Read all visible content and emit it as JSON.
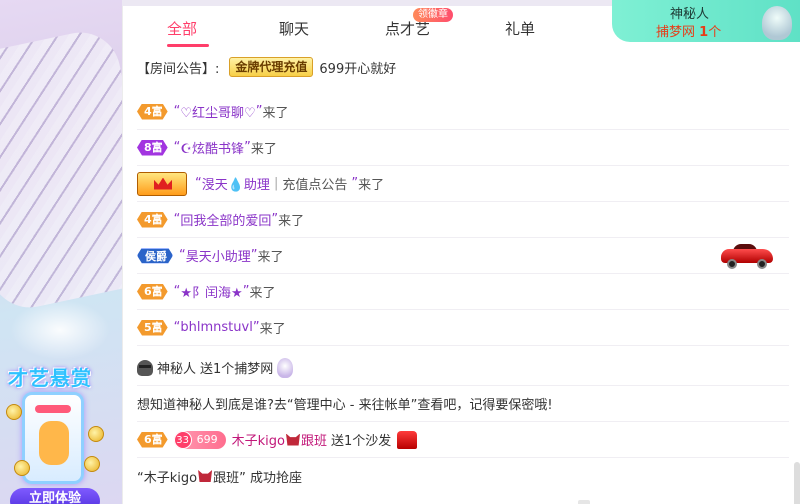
{
  "left": {
    "reward_title": "才艺悬赏",
    "join_button": "立即体验"
  },
  "tabs": [
    {
      "label": "全部",
      "active": true
    },
    {
      "label": "聊天",
      "active": false
    },
    {
      "label": "点才艺",
      "active": false,
      "badge": "领徽章"
    },
    {
      "label": "礼单",
      "active": false
    }
  ],
  "mystery": {
    "name": "神秘人",
    "gift": "捕梦网",
    "count": "1",
    "unit": "个"
  },
  "announcement": {
    "label": "【房间公告】:",
    "tag": "金牌代理充值",
    "text": "699开心就好"
  },
  "messages": [
    {
      "badge": "4富",
      "badge_color": "orange",
      "open_quote": "“",
      "name": "♡红尘哥聊♡",
      "close_quote": "”",
      "action": "来了"
    },
    {
      "badge": "8富",
      "badge_color": "purple",
      "open_quote": "“",
      "name": "☪炫酷书锋",
      "close_quote": "”",
      "action": "来了"
    },
    {
      "badge": "",
      "badge_color": "crown",
      "open_quote": "“",
      "name": "渂天💧助理",
      "extra": "充值点公告",
      "close_quote": "”",
      "action": "来了"
    },
    {
      "badge": "4富",
      "badge_color": "orange",
      "open_quote": "“",
      "name": "回我全部的爱回",
      "close_quote": "”",
      "action": "来了"
    },
    {
      "badge": "侯爵",
      "badge_color": "blue",
      "open_quote": "“",
      "name": "昊天小助理",
      "close_quote": "”",
      "action": "来了",
      "car": true
    },
    {
      "badge": "6富",
      "badge_color": "orange",
      "open_quote": "“",
      "name": "★阝闰海★",
      "close_quote": "”",
      "action": "来了"
    },
    {
      "badge": "5富",
      "badge_color": "orange",
      "open_quote": "“",
      "name": "bhlmnstuvl",
      "close_quote": "”",
      "action": "来了"
    }
  ],
  "gift_line": {
    "user": "神秘人",
    "text": "送1个捕梦网"
  },
  "hint_line": "想知道神秘人到底是谁?去“管理中心 - 来往帐单”查看吧，记得要保密哦!",
  "sofa_line": {
    "badge": "6富",
    "fan_level": "33",
    "fan_value": "699",
    "user": "木子kigo",
    "user_suffix": "跟班",
    "text": "送1个沙发"
  },
  "seat_line": {
    "prefix": "“木子kigo",
    "suffix": "跟班” 成功抢座"
  },
  "colors": {
    "accent": "#ff3e6a",
    "username": "#8a34c8",
    "mystery_bg": "#5fe1c6"
  }
}
